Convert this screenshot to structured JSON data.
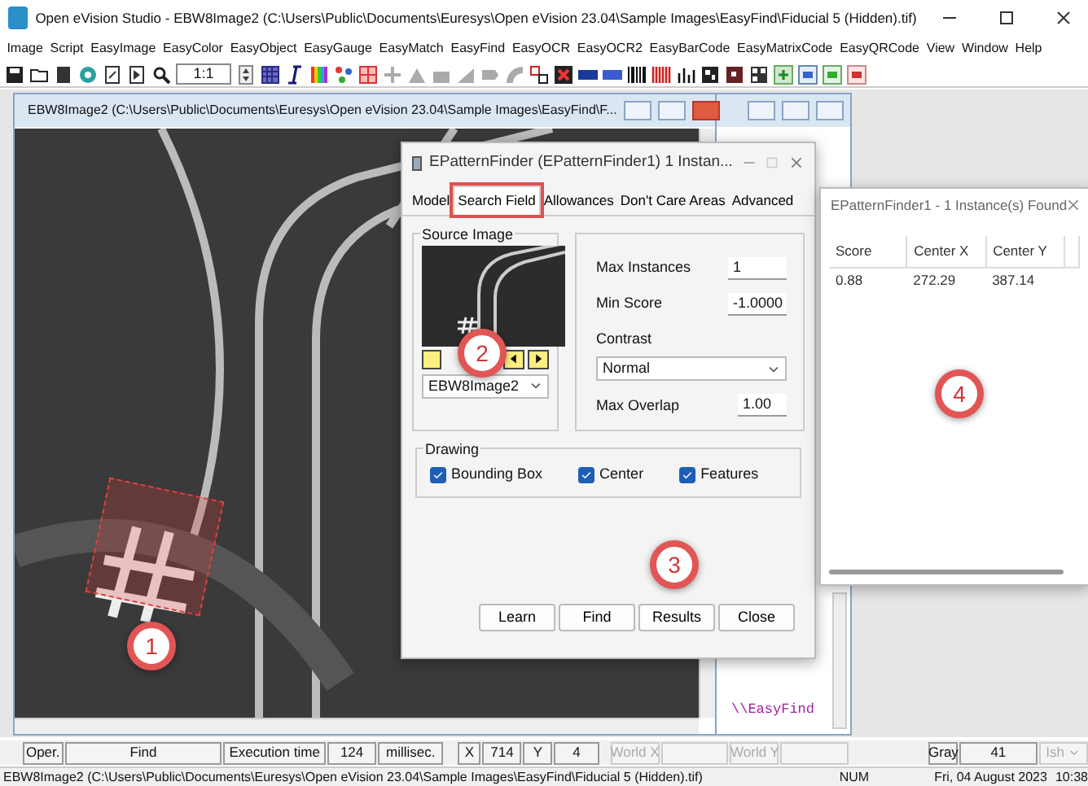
{
  "window": {
    "title": "Open eVision Studio - EBW8Image2 (C:\\Users\\Public\\Documents\\Euresys\\Open eVision 23.04\\Sample Images\\EasyFind\\Fiducial 5 (Hidden).tif)"
  },
  "menu": [
    "Image",
    "Script",
    "EasyImage",
    "EasyColor",
    "EasyObject",
    "EasyGauge",
    "EasyMatch",
    "EasyFind",
    "EasyOCR",
    "EasyOCR2",
    "EasyBarCode",
    "EasyMatrixCode",
    "EasyQRCode",
    "View",
    "Window",
    "Help"
  ],
  "toolbar": {
    "zoom": "1:1"
  },
  "image_window": {
    "title": "EBW8Image2 (C:\\Users\\Public\\Documents\\Euresys\\Open eVision 23.04\\Sample Images\\EasyFind\\F..."
  },
  "script_window": {
    "text": "\\\\EasyFind"
  },
  "dialog": {
    "title": "EPatternFinder (EPatternFinder1) 1 Instan...",
    "tabs": [
      {
        "label": "Model",
        "selected": false
      },
      {
        "label": "Search Field",
        "selected": true
      },
      {
        "label": "Allowances",
        "selected": false
      },
      {
        "label": "Don't Care Areas",
        "selected": false
      },
      {
        "label": "Advanced",
        "selected": false
      }
    ],
    "source_image": {
      "label": "Source Image",
      "selection": "EBW8Image2"
    },
    "fields": [
      {
        "label": "Max Instances",
        "value": "1"
      },
      {
        "label": "Min Score",
        "value": "-1.0000"
      }
    ],
    "contrast": {
      "label": "Contrast",
      "value": "Normal"
    },
    "max_overlap": {
      "label": "Max Overlap",
      "value": "1.00"
    },
    "drawing": {
      "label": "Drawing",
      "options": [
        {
          "label": "Bounding Box",
          "checked": true
        },
        {
          "label": "Center",
          "checked": true
        },
        {
          "label": "Features",
          "checked": true
        }
      ]
    },
    "buttons": [
      "Learn",
      "Find",
      "Results",
      "Close"
    ]
  },
  "results": {
    "title": "EPatternFinder1 - 1 Instance(s) Found",
    "columns": [
      "Score",
      "Center X",
      "Center Y"
    ],
    "rows": [
      [
        "0.88",
        "272.29",
        "387.14"
      ]
    ]
  },
  "status": [
    {
      "text": "Oper.",
      "kind": "label"
    },
    {
      "text": "Find",
      "kind": "value"
    },
    {
      "text": "Execution time",
      "kind": "value"
    },
    {
      "text": "124",
      "kind": "value"
    },
    {
      "text": "millisec.",
      "kind": "value"
    },
    {
      "text": "X",
      "kind": "label"
    },
    {
      "text": "714",
      "kind": "value"
    },
    {
      "text": "Y",
      "kind": "label"
    },
    {
      "text": "4",
      "kind": "value"
    },
    {
      "text": "World X",
      "kind": "disabled"
    },
    {
      "text": "World Y",
      "kind": "disabled"
    },
    {
      "text": "Gray",
      "kind": "label"
    },
    {
      "text": "41",
      "kind": "value"
    },
    {
      "text": "Ish",
      "kind": "dropdown"
    }
  ],
  "status_bar": {
    "path": "EBW8Image2 (C:\\Users\\Public\\Documents\\Euresys\\Open eVision 23.04\\Sample Images\\EasyFind\\Fiducial 5 (Hidden).tif)",
    "num": "NUM",
    "date": "Fri, 04 August 2023",
    "time": "10:38"
  },
  "callouts": [
    "1",
    "2",
    "3",
    "4"
  ]
}
